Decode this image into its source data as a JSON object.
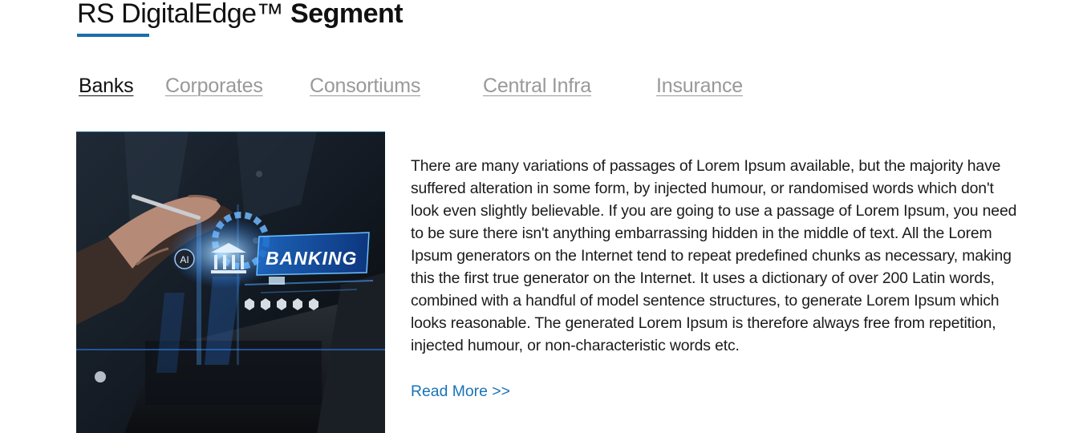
{
  "section": {
    "title_regular": "RS DigitalEdge™",
    "title_bold": "Segment"
  },
  "tabs": [
    {
      "label": "Banks",
      "active": true
    },
    {
      "label": "Corporates",
      "active": false
    },
    {
      "label": "Consortiums",
      "active": false
    },
    {
      "label": "Central Infra",
      "active": false
    },
    {
      "label": "Insurance",
      "active": false
    }
  ],
  "content": {
    "image": {
      "overlay_text": "BANKING",
      "badge_text": "AI"
    },
    "description": "There are many variations of passages of Lorem Ipsum available, but the majority have suffered alteration in some form, by injected humour, or randomised words which don't look even slightly believable. If you are going to use a passage of Lorem Ipsum, you need to be sure there isn't anything embarrassing hidden in the middle of text. All the Lorem Ipsum generators on the Internet tend to repeat predefined chunks as necessary, making this the first true generator on the Internet. It uses a dictionary of over 200 Latin words, combined with a handful of model sentence structures, to generate Lorem Ipsum which looks reasonable. The generated Lorem Ipsum is therefore always free from repetition, injected humour, or non-characteristic words etc.",
    "read_more_label": "Read More >>"
  },
  "colors": {
    "accent": "#1a6ea8",
    "link": "#1a73b7",
    "tab_inactive": "#999999",
    "tab_active": "#111111"
  }
}
